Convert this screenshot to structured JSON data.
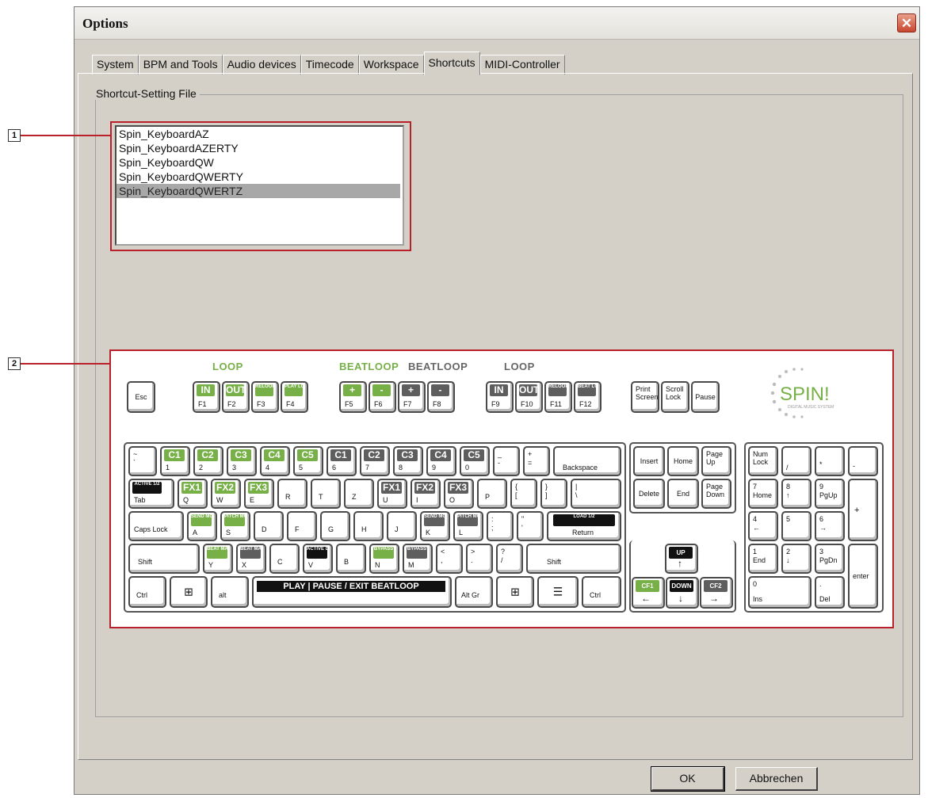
{
  "window": {
    "title": "Options",
    "close_glyph": "✕"
  },
  "tabs": [
    {
      "label": "System",
      "active": false
    },
    {
      "label": "BPM and Tools",
      "active": false
    },
    {
      "label": "Audio devices",
      "active": false
    },
    {
      "label": "Timecode",
      "active": false
    },
    {
      "label": "Workspace",
      "active": false
    },
    {
      "label": "Shortcuts",
      "active": true
    },
    {
      "label": "MIDI-Controller",
      "active": false
    }
  ],
  "group": {
    "label": "Shortcut-Setting File"
  },
  "callouts": [
    {
      "number": "1"
    },
    {
      "number": "2"
    }
  ],
  "files": {
    "items": [
      "Spin_KeyboardAZ",
      "Spin_KeyboardAZERTY",
      "Spin_KeyboardQW",
      "Spin_KeyboardQWERTY",
      "Spin_KeyboardQWERTZ"
    ],
    "selected": "Spin_KeyboardQWERTZ"
  },
  "keyboard": {
    "section_labels": {
      "loop_left": "LOOP",
      "beatloop_green": "BEATLOOP",
      "beatloop_gray": "BEATLOOP",
      "loop_right": "LOOP"
    },
    "fkeys": {
      "esc": "Esc",
      "f1_tag": "IN",
      "f1": "F1",
      "f2_tag": "OUT",
      "f2": "F2",
      "f3_tag": "RELOOP",
      "f3": "F3",
      "f4_tag": "PLAY LOOP",
      "f4": "F4",
      "f5_tag": "+",
      "f5": "F5",
      "f6_tag": "-",
      "f6": "F6",
      "f7_tag": "+",
      "f7": "F7",
      "f8_tag": "-",
      "f8": "F8",
      "f9_tag": "IN",
      "f9": "F9",
      "f10_tag": "OUT",
      "f10": "F10",
      "f11_tag": "RELOOP",
      "f11": "F11",
      "f12_tag": "BEAT LOOP",
      "f12": "F12",
      "print": "Print Screen",
      "scroll": "Scroll Lock",
      "pause": "Pause"
    },
    "num_row": {
      "k0_top": "~",
      "k0_bot": "`",
      "c1": "C1",
      "c2": "C2",
      "c3": "C3",
      "c4": "C4",
      "c5": "C5",
      "c1b": "C1",
      "c2b": "C2",
      "c3b": "C3",
      "c4b": "C4",
      "c5b": "C5",
      "n1": "1",
      "n2": "2",
      "n3": "3",
      "n4": "4",
      "n5": "5",
      "n6": "6",
      "n7": "7",
      "n8": "8",
      "n9": "9",
      "n0": "0",
      "minus_top": "_",
      "minus_bot": "-",
      "eq_top": "+",
      "eq_bot": "=",
      "backspace": "Backspace"
    },
    "q_row": {
      "tab_tag": "ACTIVE 1/2",
      "tab": "Tab",
      "fx1": "FX1",
      "fx2": "FX2",
      "fx3": "FX3",
      "fx1b": "FX1",
      "fx2b": "FX2",
      "fx3b": "FX3",
      "q": "Q",
      "w": "W",
      "e": "E",
      "r": "R",
      "t": "T",
      "z": "Z",
      "u": "U",
      "i": "I",
      "o": "O",
      "p": "P",
      "br1_top": "{",
      "br1_bot": "[",
      "br2_top": "}",
      "br2_bot": "]",
      "bs_top": "|",
      "bs_bot": "\\"
    },
    "a_row": {
      "caps": "Caps Lock",
      "a_tag": "SEND MODE",
      "a": "A",
      "s_tag": "PITCH MODE",
      "s": "S",
      "d": "D",
      "f": "F",
      "g": "G",
      "h": "H",
      "j": "J",
      "k_tag": "SEND MODE",
      "k": "K",
      "l_tag": "PITCH MODE",
      "l": "L",
      "semi_top": ":",
      "semi_bot": ";",
      "quote_top": "\"",
      "quote_bot": "'",
      "ret_tag": "LOAD 1/2",
      "ret": "Return"
    },
    "y_row": {
      "shift": "Shift",
      "y_tag": "BEAT MATCH 1",
      "y": "Y",
      "x_tag": "BEAT MATCH 2",
      "x": "X",
      "c": "C",
      "v_tag": "ACTIVE LIBRARY",
      "v": "V",
      "b": "B",
      "n_tag": "BYPASS",
      "n": "N",
      "m_tag": "BYPASS",
      "m": "M",
      "lt_top": "<",
      "lt_bot": ",",
      "gt_top": ">",
      "gt_bot": ".",
      "q_top": "?",
      "q_bot": "/",
      "shift_r": "Shift"
    },
    "bottom_row": {
      "ctrl": "Ctrl",
      "win": "⊞",
      "alt": "alt",
      "space": "PLAY | PAUSE / EXIT BEATLOOP",
      "altgr": "Alt Gr",
      "win_r": "⊞",
      "menu": "☰",
      "ctrl_r": "Ctrl"
    },
    "nav": {
      "insert": "Insert",
      "home": "Home",
      "pgup": "Page Up",
      "delete": "Delete",
      "end": "End",
      "pgdn": "Page Down"
    },
    "arrows": {
      "up_tag": "UP",
      "up": "↑",
      "left_tag": "CF1",
      "left": "←",
      "down_tag": "DOWN",
      "down": "↓",
      "right_tag": "CF2",
      "right": "→"
    },
    "numpad": {
      "numlock": "Num Lock",
      "div": "/",
      "mul": "*",
      "sub": "-",
      "n7": "7",
      "n7b": "Home",
      "n8": "8",
      "n8b": "↑",
      "n9": "9",
      "n9b": "PgUp",
      "add": "+",
      "n4": "4",
      "n4b": "←",
      "n5": "5",
      "n6": "6",
      "n6b": "→",
      "n1": "1",
      "n1b": "End",
      "n2": "2",
      "n2b": "↓",
      "n3": "3",
      "n3b": "PgDn",
      "enter": "enter",
      "n0": "0",
      "n0b": "Ins",
      "dot": ".",
      "dotb": "Del"
    },
    "logo": {
      "text": "SPIN!",
      "tagline": "DIGITAL MUSIC SYSTEM"
    }
  },
  "buttons": {
    "ok": "OK",
    "cancel": "Abbrechen"
  }
}
